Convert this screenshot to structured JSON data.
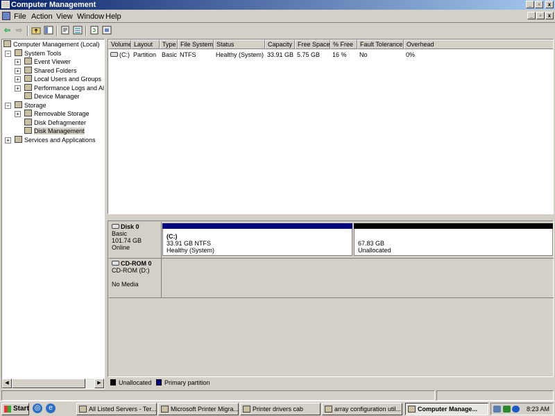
{
  "window": {
    "title": "Computer Management",
    "caption_buttons": [
      "_",
      "▫",
      "x"
    ],
    "mdi_buttons": [
      "_",
      "▫",
      "x"
    ]
  },
  "menu": [
    "File",
    "Action",
    "View",
    "Window",
    "Help"
  ],
  "toolbar": {
    "icons": [
      "back-icon",
      "forward-icon",
      "up-icon",
      "show-hide-tree-icon",
      "properties-icon",
      "export-list-icon",
      "refresh-icon",
      "help-icon"
    ],
    "back": "⇦",
    "forward": "⇨"
  },
  "tree": [
    {
      "label": "Computer Management (Local)",
      "level": 0,
      "expander": "",
      "icon": "computer-icon"
    },
    {
      "label": "System Tools",
      "level": 1,
      "expander": "−",
      "icon": "system-tools-icon"
    },
    {
      "label": "Event Viewer",
      "level": 2,
      "expander": "+",
      "icon": "event-viewer-icon"
    },
    {
      "label": "Shared Folders",
      "level": 2,
      "expander": "+",
      "icon": "shared-folders-icon"
    },
    {
      "label": "Local Users and Groups",
      "level": 2,
      "expander": "+",
      "icon": "users-groups-icon"
    },
    {
      "label": "Performance Logs and Alerts",
      "level": 2,
      "expander": "+",
      "icon": "performance-logs-icon"
    },
    {
      "label": "Device Manager",
      "level": 2,
      "expander": "",
      "icon": "device-manager-icon"
    },
    {
      "label": "Storage",
      "level": 1,
      "expander": "−",
      "icon": "storage-icon"
    },
    {
      "label": "Removable Storage",
      "level": 2,
      "expander": "+",
      "icon": "removable-storage-icon"
    },
    {
      "label": "Disk Defragmenter",
      "level": 2,
      "expander": "",
      "icon": "disk-defragmenter-icon"
    },
    {
      "label": "Disk Management",
      "level": 2,
      "expander": "",
      "icon": "disk-management-icon",
      "selected": true
    },
    {
      "label": "Services and Applications",
      "level": 1,
      "expander": "+",
      "icon": "services-icon"
    }
  ],
  "volume_list": {
    "columns": [
      "Volume",
      "Layout",
      "Type",
      "File System",
      "Status",
      "Capacity",
      "Free Space",
      "% Free",
      "Fault Tolerance",
      "Overhead"
    ],
    "rows": [
      [
        "(C:)",
        "Partition",
        "Basic",
        "NTFS",
        "Healthy (System)",
        "33.91 GB",
        "5.75 GB",
        "16 %",
        "No",
        "0%"
      ]
    ]
  },
  "disks": [
    {
      "name": "Disk 0",
      "type": "Basic",
      "size": "101.74 GB",
      "status": "Online",
      "partitions": [
        {
          "label": "(C:)",
          "detail": "33.91 GB NTFS",
          "status": "Healthy (System)",
          "color": "#00007f",
          "share": 0.488
        },
        {
          "label": "",
          "detail": "67.83 GB",
          "status": "Unallocated",
          "color": "#000000",
          "share": 0.512
        }
      ]
    },
    {
      "name": "CD-ROM 0",
      "type": "CD-ROM (D:)",
      "size": "",
      "status": "No Media",
      "partitions": []
    }
  ],
  "legend": [
    {
      "label": "Unallocated",
      "color": "#000000"
    },
    {
      "label": "Primary partition",
      "color": "#00007f"
    }
  ],
  "taskbar": {
    "start": "Start",
    "tasks": [
      {
        "label": "All Listed Servers - Ter...",
        "active": false
      },
      {
        "label": "Microsoft Printer Migra...",
        "active": false
      },
      {
        "label": "Printer drivers cab",
        "active": false
      },
      {
        "label": "array configuration util...",
        "active": false
      },
      {
        "label": "Computer Manage...",
        "active": true
      }
    ],
    "clock": "8:23 AM"
  }
}
